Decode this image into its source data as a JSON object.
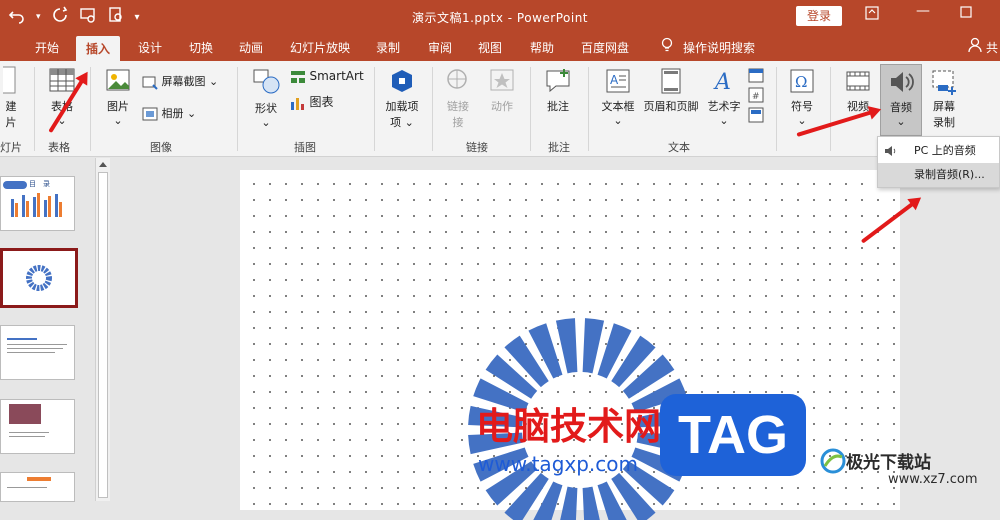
{
  "window": {
    "title": "演示文稿1.pptx  -  PowerPoint",
    "login_label": "登录"
  },
  "tabs": [
    {
      "label": "开始"
    },
    {
      "label": "插入"
    },
    {
      "label": "设计"
    },
    {
      "label": "切换"
    },
    {
      "label": "动画"
    },
    {
      "label": "幻灯片放映"
    },
    {
      "label": "录制"
    },
    {
      "label": "审阅"
    },
    {
      "label": "视图"
    },
    {
      "label": "帮助"
    },
    {
      "label": "百度网盘"
    },
    {
      "label": "操作说明搜索"
    }
  ],
  "share_label": "共",
  "ribbon": {
    "buttons": {
      "new_slide_top": "建",
      "new_slide_bottom": "片",
      "table": "表格",
      "picture": "图片",
      "screenshot": "屏幕截图",
      "album": "相册",
      "shapes": "形状",
      "smartart": "SmartArt",
      "chart": "图表",
      "addins": "加载项",
      "link": "链接",
      "action": "动作",
      "comment": "批注",
      "textbox": "文本框",
      "header_footer": "页眉和页脚",
      "wordart": "艺术字",
      "symbol": "符号",
      "video": "视频",
      "audio": "音频",
      "screen_record_top": "屏幕",
      "screen_record_bottom": "录制"
    },
    "groups": {
      "slides": "灯片",
      "tables": "表格",
      "images": "图像",
      "illustrations": "插图",
      "links": "链接",
      "comments": "批注",
      "text": "文本"
    }
  },
  "audio_menu": {
    "items": [
      {
        "label": "PC 上的音频(P)..."
      },
      {
        "label": "录制音频(R)..."
      }
    ]
  },
  "thumbnails": {
    "slide1_title": "目　录"
  },
  "watermark": {
    "cn_text": "电脑技术网",
    "url": "www.tagxp.com",
    "tag": "TAG",
    "site_name": "极光下载站",
    "site_url": "www.xz7.com"
  },
  "colors": {
    "title_bar": "#b7472a",
    "accent_blue": "#4472c4",
    "arrow_red": "#e21a1a"
  }
}
